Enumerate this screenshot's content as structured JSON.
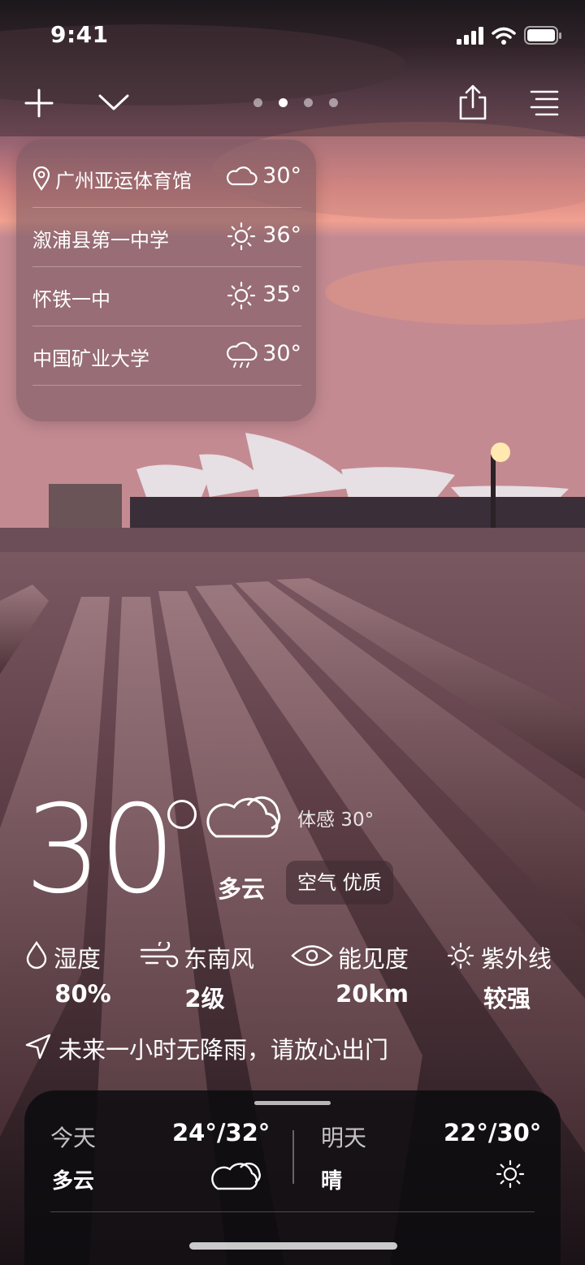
{
  "status_bar": {
    "time": "9:41"
  },
  "top_bar": {
    "page_count": 4,
    "active_page": 2
  },
  "locations": [
    {
      "name": "广州亚运体育馆",
      "temp": "30°",
      "icon": "cloud-icon",
      "current": true
    },
    {
      "name": "溆浦县第一中学",
      "temp": "36°",
      "icon": "sun-icon",
      "current": false
    },
    {
      "name": "怀铁一中",
      "temp": "35°",
      "icon": "sun-icon",
      "current": false
    },
    {
      "name": "中国矿业大学",
      "temp": "30°",
      "icon": "cloud-rain-icon",
      "current": false
    }
  ],
  "current": {
    "temperature": "30",
    "feels_like": "体感 30°",
    "condition": "多云",
    "air_quality": "空气 优质"
  },
  "metrics": [
    {
      "label": "湿度",
      "value": "80%",
      "icon": "drop-icon"
    },
    {
      "label": "东南风",
      "value": "2级",
      "icon": "wind-icon"
    },
    {
      "label": "能见度",
      "value": "20km",
      "icon": "eye-icon"
    },
    {
      "label": "紫外线",
      "value": "较强",
      "icon": "uv-sun-icon"
    }
  ],
  "rain_notice": "未来一小时无降雨，请放心出门",
  "forecast": {
    "today": {
      "day": "今天",
      "range": "24°/32°",
      "condition": "多云",
      "icon": "cloud-icon"
    },
    "tomorrow": {
      "day": "明天",
      "range": "22°/30°",
      "condition": "晴",
      "icon": "sun-icon"
    }
  },
  "colors": {
    "sky_top": "#2a2228",
    "sky_glow": "#e8907e",
    "deck": "#5a3c42"
  }
}
